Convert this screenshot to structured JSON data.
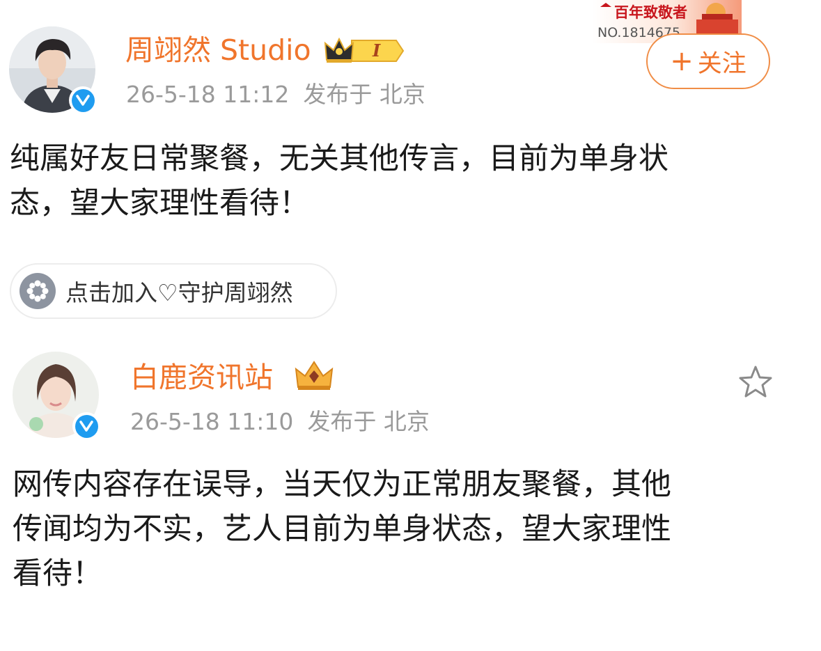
{
  "header_badge": {
    "title": "百年致敬者",
    "number": "NO.1814675"
  },
  "posts": [
    {
      "username": "周翊然 Studio",
      "timestamp": "26-5-18 11:12",
      "location_label": "发布于 北京",
      "follow_label": "关注",
      "rank_badge": "I",
      "text_lines": [
        "纯属好友日常聚餐，无关其他传言，目前为单身状",
        "态，望大家理性看待！"
      ],
      "tag": {
        "label": "点击加入♡守护周翊然",
        "icon": "flower-icon"
      }
    },
    {
      "username": "白鹿资讯站",
      "timestamp": "26-5-18 11:10",
      "location_label": "发布于 北京",
      "favorite_icon": "star-icon",
      "text_lines": [
        "网传内容存在误导，当天仅为正常朋友聚餐，其他",
        "传闻均为不实，艺人目前为单身状态，望大家理性",
        "看待！"
      ]
    }
  ],
  "colors": {
    "username": "#f0752c",
    "meta": "#9a9a9a",
    "body_text": "#1a1a1a",
    "verified": "#1f9cf0",
    "follow_border": "#f08d46"
  }
}
